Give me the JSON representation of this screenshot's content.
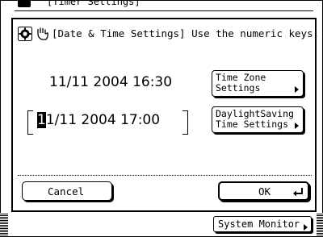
{
  "background_window": {
    "title": "[Timer Settings]"
  },
  "dialog": {
    "header_text": "[Date & Time Settings] Use the numeric keys.",
    "current_datetime": "11/11 2004 16:30",
    "new_datetime": {
      "cursor_char": "1",
      "rest": "1/11 2004 17:00"
    },
    "time_zone_button": {
      "line1": "Time Zone",
      "line2": "Settings"
    },
    "daylight_button": {
      "line1": "DaylightSaving",
      "line2": "Time Settings"
    },
    "cancel_label": "Cancel",
    "ok_label": "OK"
  },
  "status_bar": {
    "system_monitor_label": "System Monitor"
  }
}
